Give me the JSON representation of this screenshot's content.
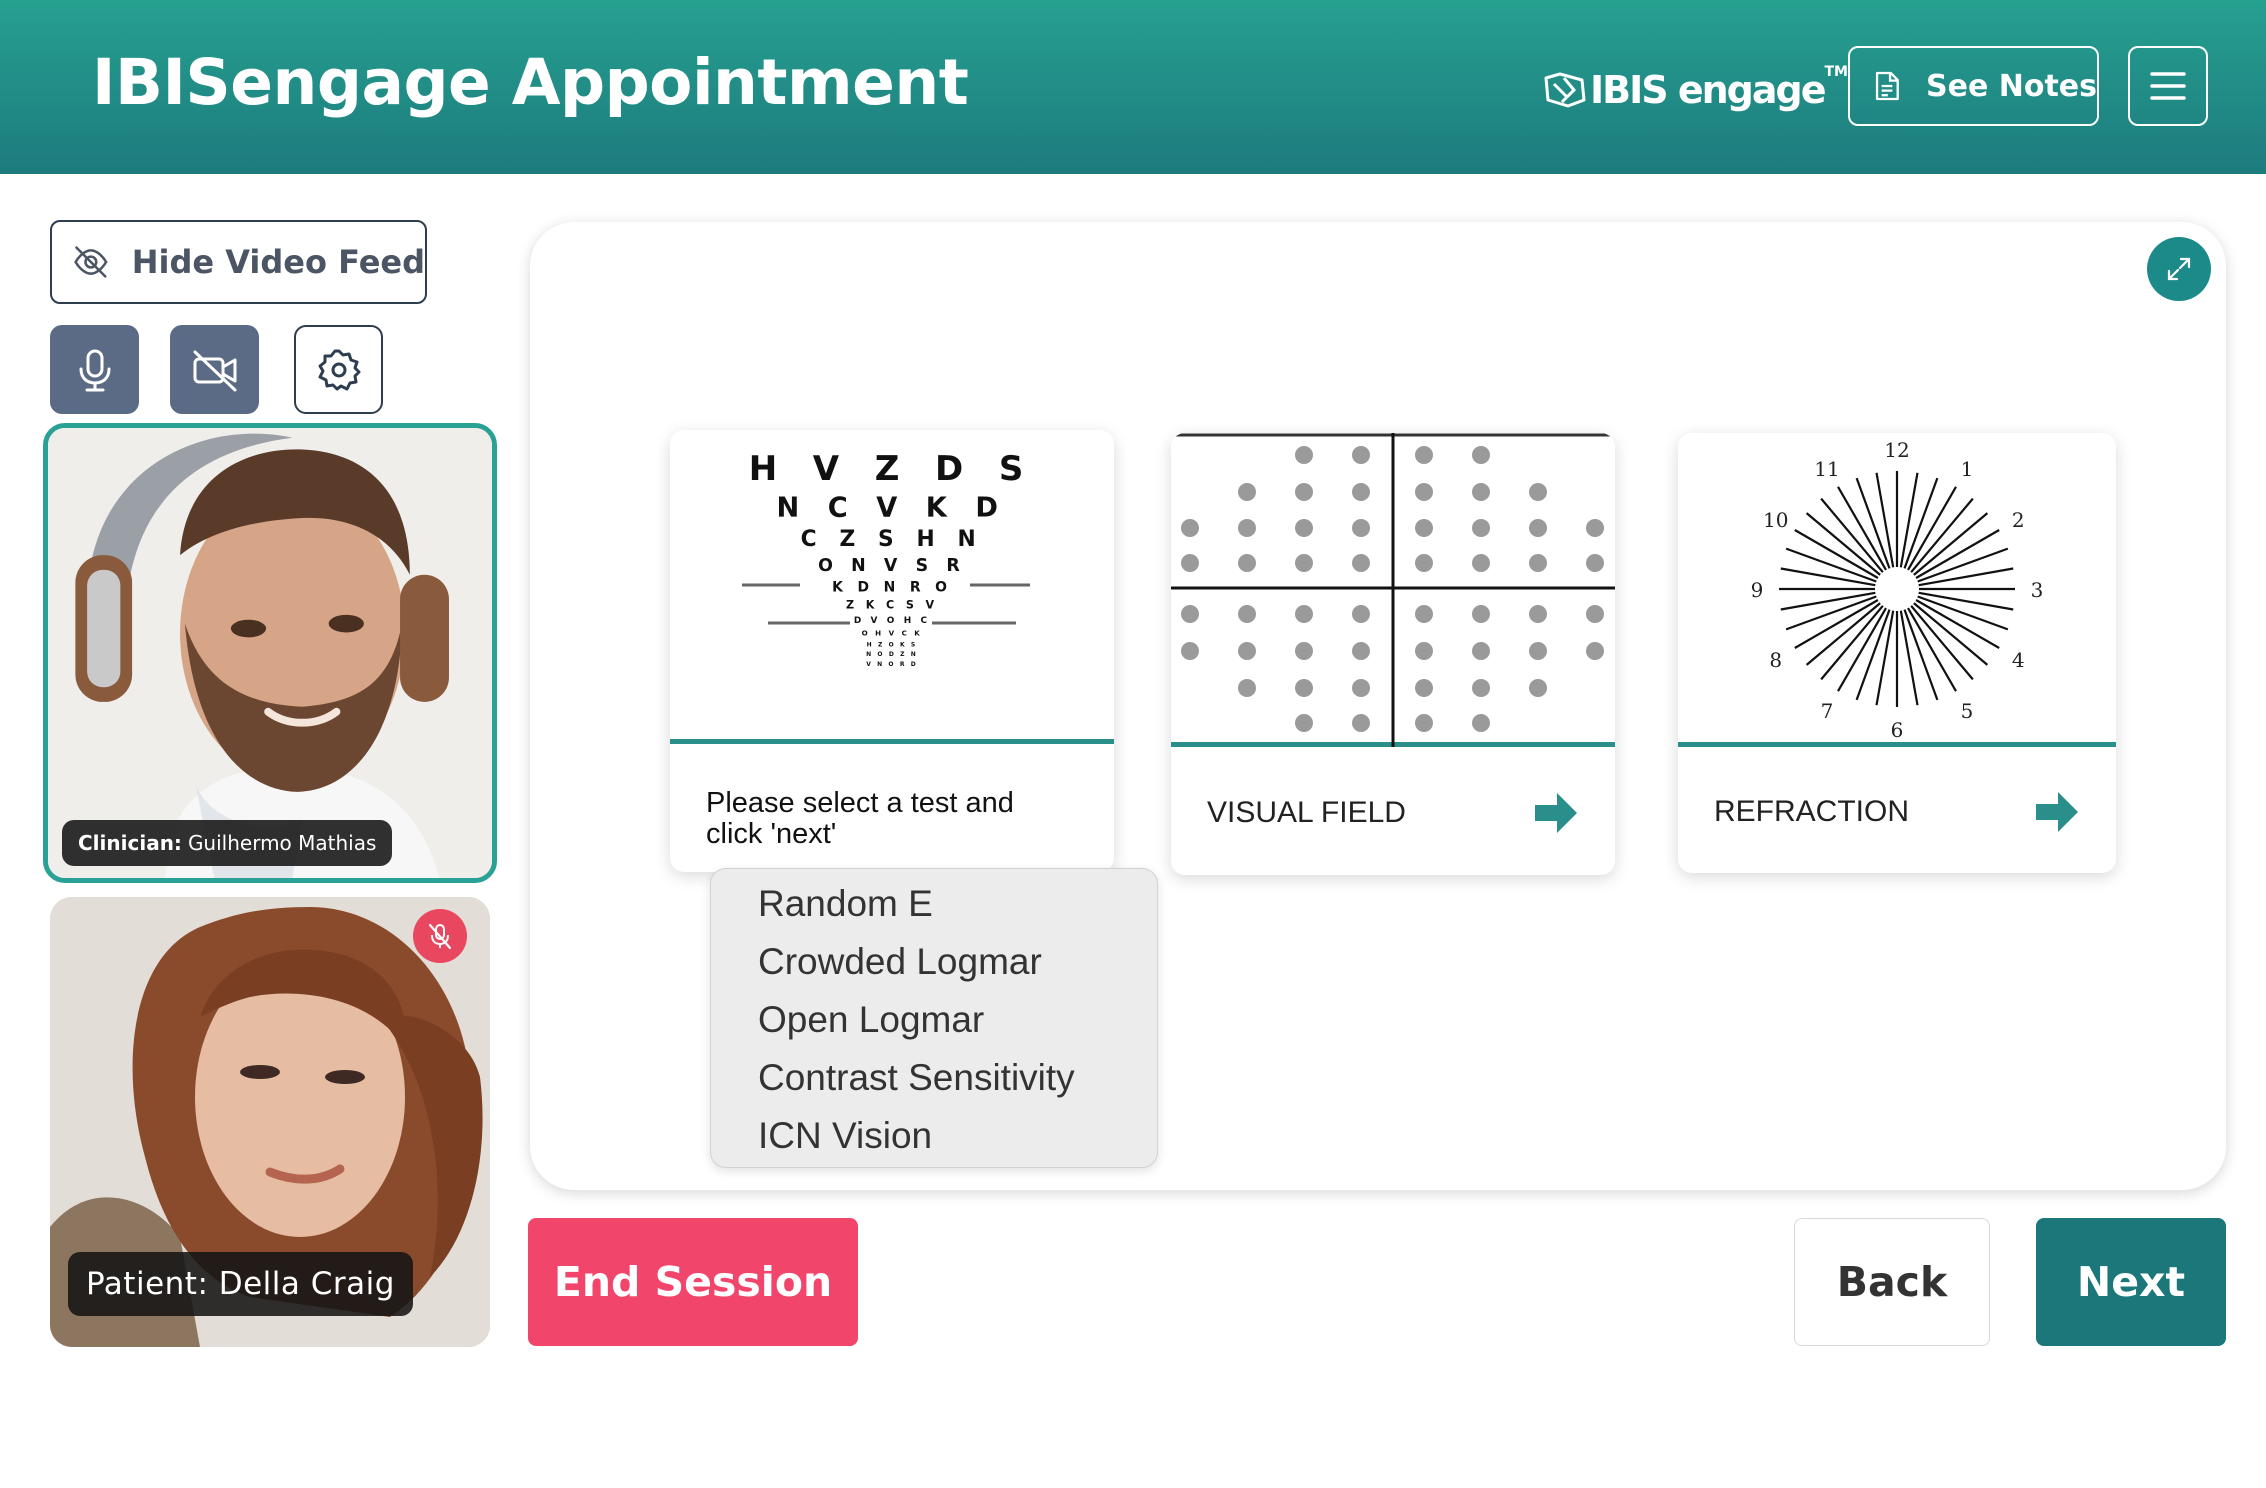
{
  "header": {
    "title": "IBISengage Appointment",
    "brand_text": "IBIS engage",
    "brand_tm": "TM",
    "see_notes_label": "See Notes",
    "icons": {
      "brand": "ibis-logo-icon",
      "notes": "document-icon",
      "menu": "hamburger-menu-icon"
    }
  },
  "sidebar": {
    "hide_video_label": "Hide Video Feed",
    "controls": [
      {
        "name": "microphone",
        "icon": "microphone-icon"
      },
      {
        "name": "camera-off",
        "icon": "video-off-icon"
      },
      {
        "name": "settings",
        "icon": "gear-icon"
      }
    ],
    "clinician": {
      "role": "Clinician:",
      "name": "Guilhermo Mathias"
    },
    "patient": {
      "label": "Patient: Della Craig",
      "muted": true
    }
  },
  "tests": {
    "visual_acuity": {
      "prompt": "Please select a test and click 'next'",
      "chart_rows": [
        "H V Z D S",
        "N C V K D",
        "C Z S H N",
        "O N V S R",
        "K D N R O",
        "Z K C S V",
        "D V O H C",
        "O H V C K",
        "H Z O K S",
        "N O D Z N",
        "V N O R D"
      ],
      "options": [
        "Random E",
        "Crowded Logmar",
        "Open Logmar",
        "Contrast Sensitivity",
        "ICN Vision"
      ]
    },
    "visual_field": {
      "label": "VISUAL FIELD"
    },
    "refraction": {
      "label": "REFRACTION",
      "clock_numbers": [
        "12",
        "1",
        "2",
        "3",
        "4",
        "5",
        "6",
        "7",
        "8",
        "9",
        "10",
        "11"
      ]
    }
  },
  "footer": {
    "end_session_label": "End Session",
    "back_label": "Back",
    "next_label": "Next"
  },
  "colors": {
    "header": "#1f8a84",
    "accent": "#2aa195",
    "end_session": "#f2456b",
    "next": "#1b7779",
    "control_bg": "#5c6b85"
  }
}
